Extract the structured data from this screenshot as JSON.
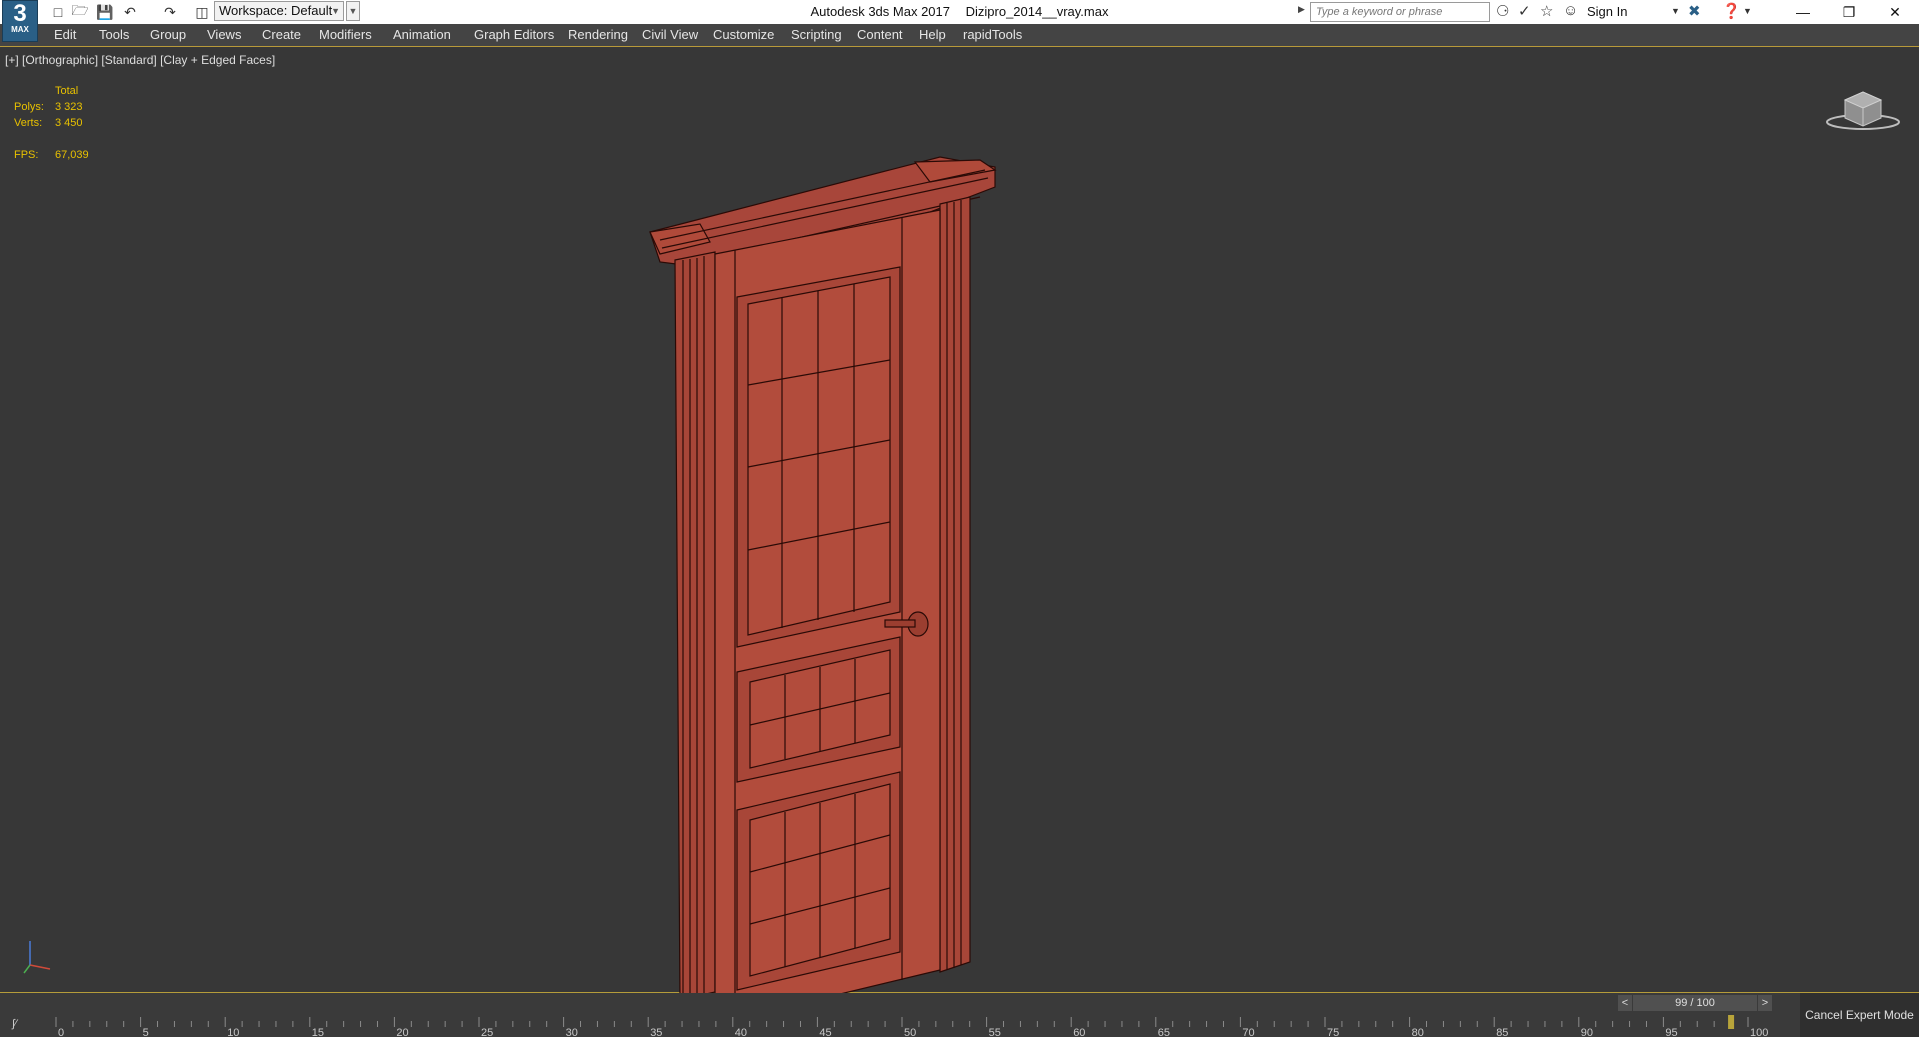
{
  "titlebar": {
    "logo_number": "3",
    "logo_text": "MAX",
    "workspace": "Workspace: Default",
    "app_title": "Autodesk 3ds Max 2017",
    "file_name": "Dizipro_2014__vray.max",
    "search_placeholder": "Type a keyword or phrase",
    "sign_in": "Sign In"
  },
  "menu": [
    "Edit",
    "Tools",
    "Group",
    "Views",
    "Create",
    "Modifiers",
    "Animation",
    "Graph Editors",
    "Rendering",
    "Civil View",
    "Customize",
    "Scripting",
    "Content",
    "Help",
    "rapidTools"
  ],
  "viewport": {
    "label": "[+] [Orthographic] [Standard] [Clay + Edged Faces]",
    "stats": {
      "total_label": "Total",
      "polys_label": "Polys:",
      "polys_value": "3 323",
      "verts_label": "Verts:",
      "verts_value": "3 450",
      "fps_label": "FPS:",
      "fps_value": "67,039"
    }
  },
  "timeline": {
    "frame_counter": "99 / 100",
    "prev": "<",
    "next": ">",
    "ticks": [
      "0",
      "5",
      "10",
      "15",
      "20",
      "25",
      "30",
      "35",
      "40",
      "45",
      "50",
      "55",
      "60",
      "65",
      "70",
      "75",
      "80",
      "85",
      "90",
      "95",
      "100"
    ],
    "cancel_expert": "Cancel Expert Mode"
  },
  "colors": {
    "door": "#b04a3a",
    "door_edge": "#2a0a06",
    "stats": "#e8c100",
    "accent_line": "#b89a3a"
  }
}
